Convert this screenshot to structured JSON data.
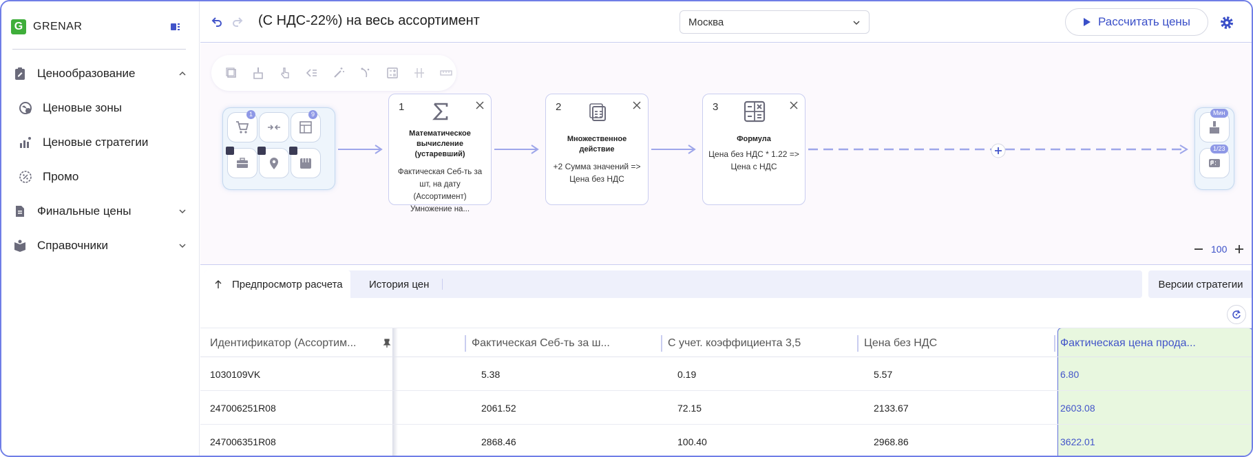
{
  "app": {
    "logo_letter": "G",
    "logo_text": "GRENAR"
  },
  "sidebar": {
    "items": [
      {
        "label": "Ценообразование",
        "expanded": true
      },
      {
        "label": "Ценовые зоны"
      },
      {
        "label": "Ценовые стратегии"
      },
      {
        "label": "Промо"
      },
      {
        "label": "Финальные цены",
        "expanded": false
      },
      {
        "label": "Справочники",
        "expanded": false
      }
    ]
  },
  "header": {
    "title": "(С НДС-22%) на весь ассортимент",
    "city": "Москва",
    "calc_button": "Рассчитать цены"
  },
  "canvas": {
    "source_badges": {
      "top": "1",
      "right": "9"
    },
    "steps": [
      {
        "num": "1",
        "title": "Математическое вычисление (устаревший)",
        "desc": "Фактическая Себ-ть за шт, на дату (Ассортимент) Умножение на..."
      },
      {
        "num": "2",
        "title": "Множественное действие",
        "desc": "+2 Сумма значений => Цена без НДС"
      },
      {
        "num": "3",
        "title": "Формула",
        "desc": "Цена без НДС * 1.22 => Цена с НДС"
      }
    ],
    "end_badges": {
      "top": "Мин",
      "bottom": "1/23"
    },
    "zoom": "100"
  },
  "tabs": {
    "preview": "Предпросмотр расчета",
    "history": "История цен",
    "versions": "Версии стратегии"
  },
  "table": {
    "headers": [
      "Идентификатор (Ассортим...",
      "",
      "Фактическая Себ-ть за ш...",
      "С учет. коэффициента 3,5",
      "Цена без НДС",
      "Фактическая цена прода..."
    ],
    "rows": [
      [
        "1030109VK",
        "",
        "5.38",
        "0.19",
        "5.57",
        "6.80"
      ],
      [
        "247006251R08",
        "",
        "2061.52",
        "72.15",
        "2133.67",
        "2603.08"
      ],
      [
        "247006351R08",
        "",
        "2868.46",
        "100.40",
        "2968.86",
        "3622.01"
      ]
    ]
  },
  "colors": {
    "accent": "#3a4fc8",
    "highlight_col": "#e8f7df",
    "logo_green": "#3fae3a"
  }
}
